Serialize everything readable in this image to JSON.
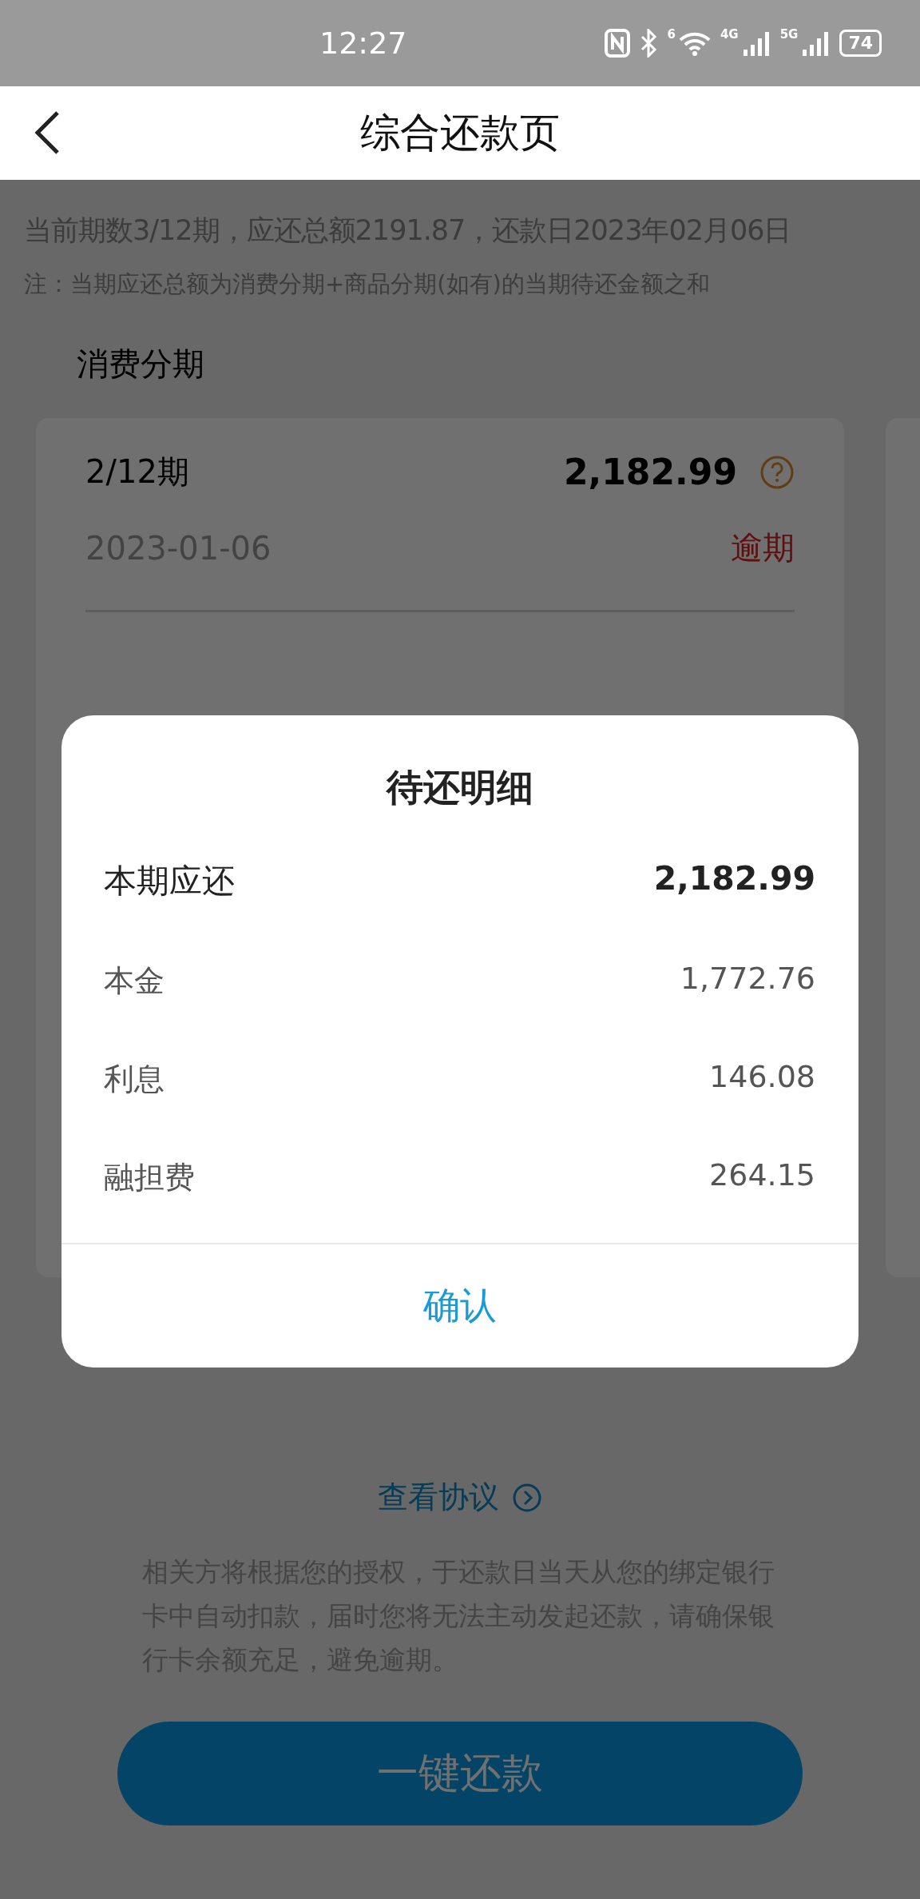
{
  "status_bar": {
    "time": "12:27",
    "wifi_label": "6",
    "network_labels": [
      "4G",
      "5G"
    ],
    "battery": "74"
  },
  "nav": {
    "title": "综合还款页"
  },
  "summary": "当前期数3/12期，应还总额2191.87，还款日2023年02月06日",
  "note": "注：当期应还总额为消费分期+商品分期(如有)的当期待还金额之和",
  "section_title": "消费分期",
  "installment": {
    "period": "2/12期",
    "amount": "2,182.99",
    "date": "2023-01-06",
    "status": "逾期",
    "overdue": true
  },
  "agreement_link": "查看协议",
  "notice": "相关方将根据您的授权，于还款日当天从您的绑定银行卡中自动扣款，届时您将无法主动发起还款，请确保银行卡余额充足，避免逾期。",
  "repay_button": "一键还款",
  "dialog": {
    "title": "待还明细",
    "rows": [
      {
        "kind": "total",
        "label": "本期应还",
        "value": "2,182.99"
      },
      {
        "kind": "item",
        "label": "本金",
        "value": "1,772.76"
      },
      {
        "kind": "item",
        "label": "利息",
        "value": "146.08"
      },
      {
        "kind": "item",
        "label": "融担费",
        "value": "264.15"
      }
    ],
    "confirm": "确认"
  }
}
